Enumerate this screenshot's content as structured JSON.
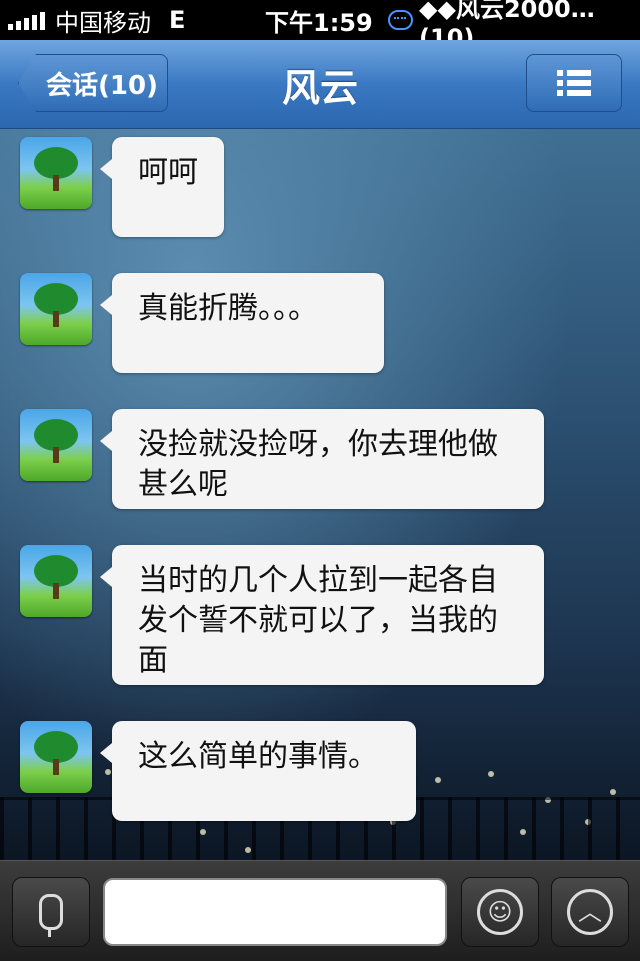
{
  "status_bar": {
    "carrier": "中国移动",
    "network": "E",
    "time": "下午1:59",
    "notification": "◆◆风云2000…(10)"
  },
  "nav": {
    "back_label": "会话(10)",
    "title": "风云",
    "menu_icon": "list-icon"
  },
  "messages": [
    {
      "text": "呵呵"
    },
    {
      "text": "真能折腾。。。"
    },
    {
      "text": "没捡就没捡呀，你去理他做甚么呢"
    },
    {
      "text": "当时的几个人拉到一起各自发个誓不就可以了，当我的面"
    },
    {
      "text": "这么简单的事情。"
    }
  ],
  "toolbar": {
    "voice_icon": "microphone-icon",
    "input_value": "",
    "emoji_icon": "smiley-icon",
    "more_icon": "chevron-up-icon"
  },
  "colors": {
    "nav_blue": "#3a78c2",
    "bubble": "#f4f4f4",
    "toolbar": "#2a2a2a"
  }
}
